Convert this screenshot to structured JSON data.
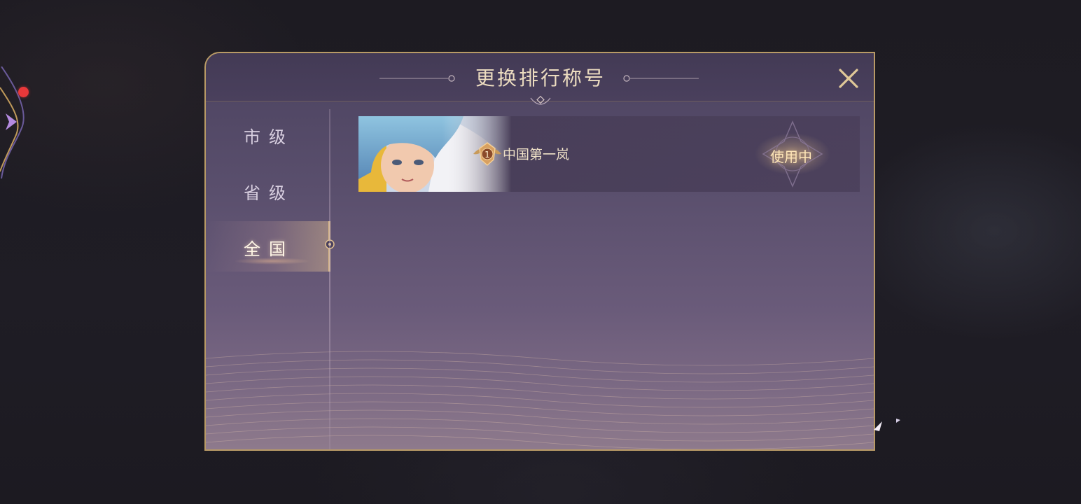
{
  "dialog": {
    "title": "更换排行称号",
    "close_icon": "close-icon"
  },
  "sidebar": {
    "items": [
      {
        "label": "市级",
        "active": false
      },
      {
        "label": "省级",
        "active": false
      },
      {
        "label": "全国",
        "active": true
      }
    ]
  },
  "titles": [
    {
      "name": "中国第一岚",
      "status": "使用中",
      "medal_icon": "rank-medal-icon",
      "medal_rank": "1"
    }
  ],
  "colors": {
    "accent_gold": "#b89a66",
    "panel_purple": "#5a4f6d",
    "notification_red": "#e8383a"
  }
}
